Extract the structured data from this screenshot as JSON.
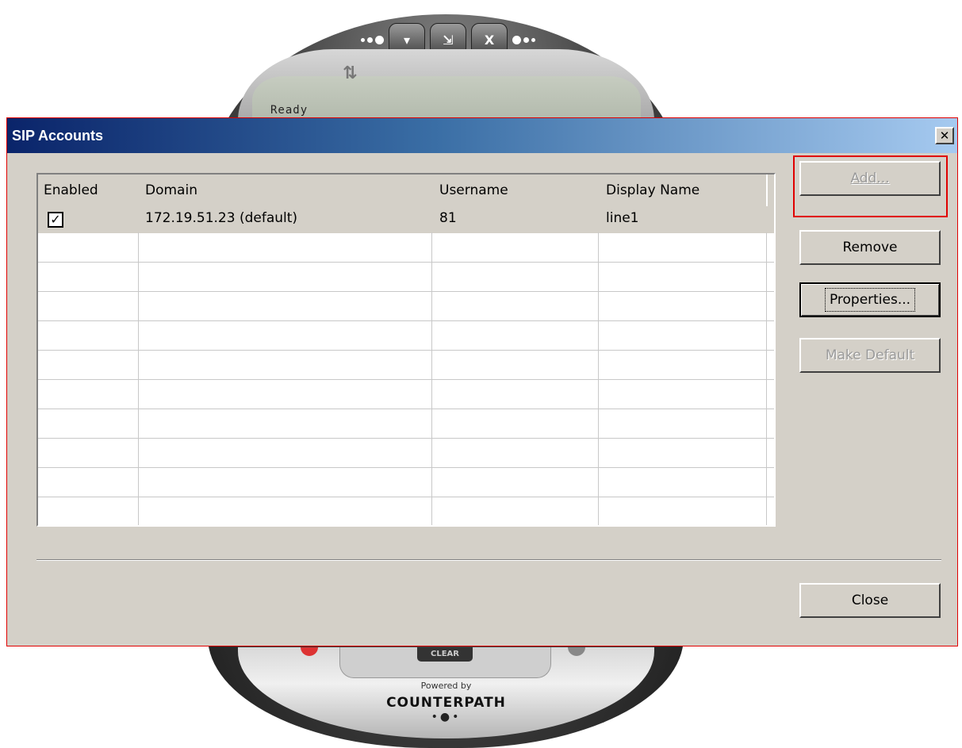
{
  "phone": {
    "status": "Ready",
    "topbar": {
      "minimize": "▾",
      "dock": "⇲",
      "close": "X"
    },
    "clear_label": "CLEAR",
    "powered_by": "Powered by",
    "brand": "COUNTERPATH",
    "brand_dots": "•●•"
  },
  "dialog": {
    "title": "SIP Accounts",
    "close_glyph": "✕",
    "columns": [
      "Enabled",
      "Domain",
      "Username",
      "Display Name"
    ],
    "rows": [
      {
        "enabled": true,
        "domain": "172.19.51.23 (default)",
        "username": "81",
        "display_name": "line1"
      }
    ],
    "buttons": {
      "add": "Add...",
      "remove": "Remove",
      "properties": "Properties...",
      "make_default": "Make Default",
      "close": "Close"
    },
    "checkbox_glyph": "✓"
  },
  "colors": {
    "title_gradient_start": "#0a246a",
    "title_gradient_end": "#a6caf0",
    "dialog_face": "#d4d0c8",
    "highlight": "#e00000"
  }
}
